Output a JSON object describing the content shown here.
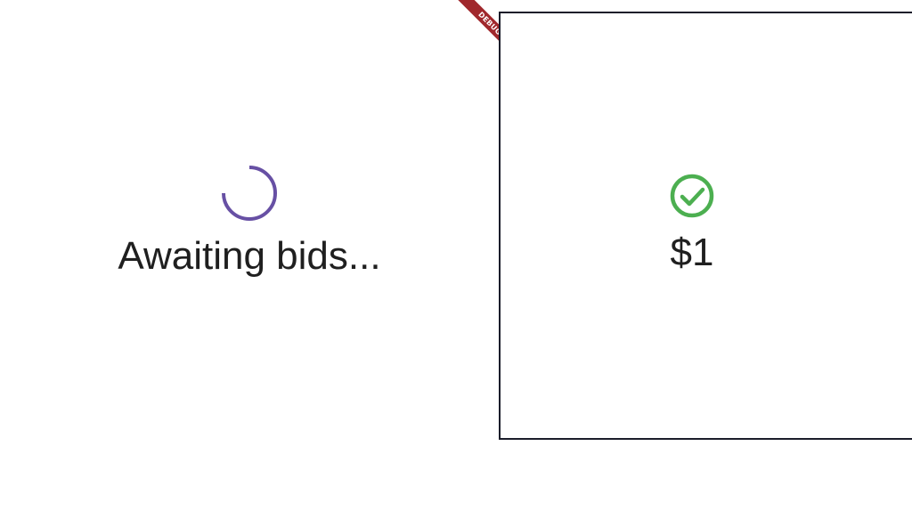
{
  "colors": {
    "background": "#ffffff",
    "text": "#1f1f1f",
    "spinner": "#6750a4",
    "success": "#4caf50",
    "border": "#1b1d2a",
    "debug_banner": "#a0282c"
  },
  "left_panel": {
    "icon": "loading-spinner-icon",
    "status_text": "Awaiting bids..."
  },
  "right_panel": {
    "icon": "check-circle-icon",
    "price_text": "$1"
  },
  "debug_banner": {
    "label": "DEBUG"
  }
}
